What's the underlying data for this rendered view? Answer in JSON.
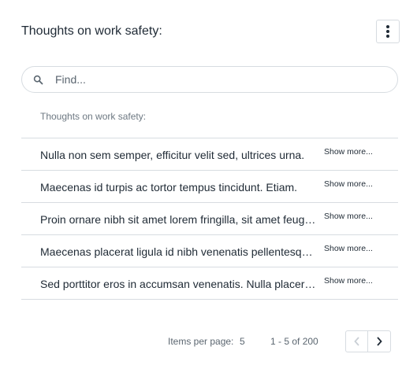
{
  "header": {
    "title": "Thoughts on work safety:",
    "menu_icon": "kebab-menu-icon"
  },
  "search": {
    "placeholder": "Find...",
    "value": "",
    "icon": "search-icon"
  },
  "list": {
    "header": "Thoughts on work safety:",
    "items": [
      {
        "text": "Nulla non sem semper, efficitur velit sed, ultrices urna.",
        "action": "Show more..."
      },
      {
        "text": "Maecenas id turpis ac tortor tempus tincidunt. Etiam.",
        "action": "Show more..."
      },
      {
        "text": "Proin ornare nibh sit amet lorem fringilla, sit amet feugiat.",
        "action": "Show more..."
      },
      {
        "text": "Maecenas placerat ligula id nibh venenatis pellentesque.",
        "action": "Show more..."
      },
      {
        "text": "Sed porttitor eros in accumsan venenatis. Nulla placerat.",
        "action": "Show more..."
      }
    ]
  },
  "pagination": {
    "items_per_page_label": "Items per page:",
    "items_per_page_value": "5",
    "range": "1 - 5 of 200",
    "prev_icon": "chevron-left-icon",
    "next_icon": "chevron-right-icon"
  },
  "colors": {
    "text": "#1f2a35",
    "muted": "#5b6670",
    "border": "#d7dce1"
  }
}
